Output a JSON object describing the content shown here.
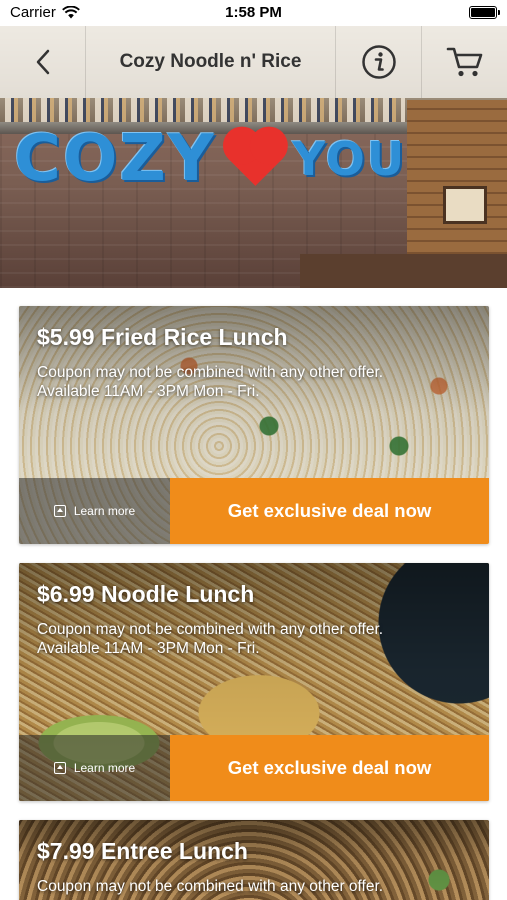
{
  "status_bar": {
    "carrier": "Carrier",
    "time": "1:58 PM",
    "icons": [
      "wifi-icon",
      "battery-icon"
    ]
  },
  "nav": {
    "title": "Cozy Noodle n' Rice",
    "back_icon": "chevron-left-icon",
    "info_icon": "info-icon",
    "cart_icon": "cart-icon"
  },
  "hero": {
    "sign_left": "COZY",
    "sign_right": "YOU",
    "sign_heart": "heart"
  },
  "deals": [
    {
      "title": "$5.99 Fried Rice Lunch",
      "line1": "Coupon may not be combined with any other offer.",
      "line2": "Available 11AM - 3PM Mon - Fri.",
      "learn_more": "Learn more",
      "cta": "Get exclusive deal now"
    },
    {
      "title": "$6.99 Noodle Lunch",
      "line1": "Coupon may not be combined with any other offer.",
      "line2": "Available 11AM - 3PM Mon - Fri.",
      "learn_more": "Learn more",
      "cta": "Get exclusive deal now"
    },
    {
      "title": "$7.99 Entree Lunch",
      "line1": "Coupon may not be combined with any other offer."
    }
  ],
  "colors": {
    "accent": "#f08c1a",
    "sign_blue": "#2e8fd6",
    "heart_red": "#e8312c"
  }
}
